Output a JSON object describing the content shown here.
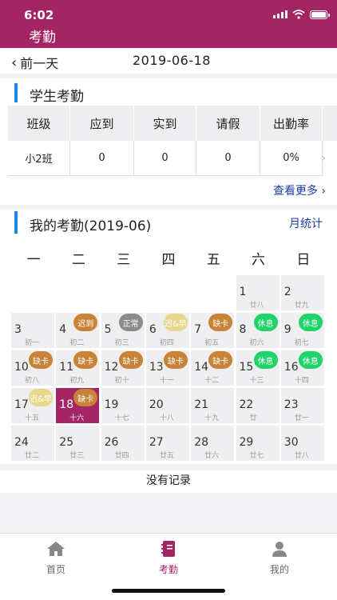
{
  "status": {
    "time": "6:02"
  },
  "header": {
    "title": "考勤"
  },
  "datebar": {
    "prev_label": "前一天",
    "date": "2019-06-18"
  },
  "student": {
    "title": "学生考勤",
    "columns": [
      "班级",
      "应到",
      "实到",
      "请假",
      "出勤率"
    ],
    "rows": [
      [
        "小2班",
        "0",
        "0",
        "0",
        "0%"
      ]
    ],
    "see_more": "查看更多"
  },
  "mine": {
    "title": "我的考勤(2019-06)",
    "monthly_link": "月统计",
    "weekdays": [
      "一",
      "二",
      "三",
      "四",
      "五",
      "六",
      "日"
    ],
    "badge_colors": {
      "late": "#c98337",
      "normal": "#8b8b8b",
      "late_early": "#e8d68a",
      "missing": "#c98337",
      "rest": "#20d46a"
    },
    "days": [
      {
        "d": "1",
        "l": "廿八",
        "col": 5,
        "row": 0
      },
      {
        "d": "2",
        "l": "廿九",
        "col": 6,
        "row": 0
      },
      {
        "d": "3",
        "l": "初一",
        "col": 0,
        "row": 1
      },
      {
        "d": "4",
        "l": "初二",
        "col": 1,
        "row": 1,
        "badge": "迟到",
        "type": "late"
      },
      {
        "d": "5",
        "l": "初三",
        "col": 2,
        "row": 1,
        "badge": "正常",
        "type": "normal"
      },
      {
        "d": "6",
        "l": "初四",
        "col": 3,
        "row": 1,
        "badge": "迟&早",
        "type": "late_early"
      },
      {
        "d": "7",
        "l": "初五",
        "col": 4,
        "row": 1,
        "badge": "缺卡",
        "type": "missing"
      },
      {
        "d": "8",
        "l": "初六",
        "col": 5,
        "row": 1,
        "badge": "休息",
        "type": "rest"
      },
      {
        "d": "9",
        "l": "初七",
        "col": 6,
        "row": 1,
        "badge": "休息",
        "type": "rest"
      },
      {
        "d": "10",
        "l": "初八",
        "col": 0,
        "row": 2,
        "badge": "缺卡",
        "type": "missing"
      },
      {
        "d": "11",
        "l": "初九",
        "col": 1,
        "row": 2,
        "badge": "缺卡",
        "type": "missing"
      },
      {
        "d": "12",
        "l": "初十",
        "col": 2,
        "row": 2,
        "badge": "缺卡",
        "type": "missing"
      },
      {
        "d": "13",
        "l": "十一",
        "col": 3,
        "row": 2,
        "badge": "缺卡",
        "type": "missing"
      },
      {
        "d": "14",
        "l": "十二",
        "col": 4,
        "row": 2,
        "badge": "缺卡",
        "type": "missing"
      },
      {
        "d": "15",
        "l": "十三",
        "col": 5,
        "row": 2,
        "badge": "休息",
        "type": "rest"
      },
      {
        "d": "16",
        "l": "十四",
        "col": 6,
        "row": 2,
        "badge": "休息",
        "type": "rest"
      },
      {
        "d": "17",
        "l": "十五",
        "col": 0,
        "row": 3,
        "badge": "迟&早",
        "type": "late_early"
      },
      {
        "d": "18",
        "l": "十六",
        "col": 1,
        "row": 3,
        "badge": "缺卡",
        "type": "missing",
        "today": true
      },
      {
        "d": "19",
        "l": "十七",
        "col": 2,
        "row": 3
      },
      {
        "d": "20",
        "l": "十八",
        "col": 3,
        "row": 3
      },
      {
        "d": "21",
        "l": "十九",
        "col": 4,
        "row": 3
      },
      {
        "d": "22",
        "l": "廿",
        "col": 5,
        "row": 3
      },
      {
        "d": "23",
        "l": "廿一",
        "col": 6,
        "row": 3
      },
      {
        "d": "24",
        "l": "廿二",
        "col": 0,
        "row": 4
      },
      {
        "d": "25",
        "l": "廿三",
        "col": 1,
        "row": 4
      },
      {
        "d": "26",
        "l": "廿四",
        "col": 2,
        "row": 4
      },
      {
        "d": "27",
        "l": "廿五",
        "col": 3,
        "row": 4
      },
      {
        "d": "28",
        "l": "廿六",
        "col": 4,
        "row": 4
      },
      {
        "d": "29",
        "l": "廿七",
        "col": 5,
        "row": 4
      },
      {
        "d": "30",
        "l": "廿八",
        "col": 6,
        "row": 4
      }
    ],
    "no_record": "没有记录"
  },
  "tabs": [
    {
      "label": "首页",
      "icon": "home-icon"
    },
    {
      "label": "考勤",
      "icon": "notebook-icon",
      "active": true
    },
    {
      "label": "我的",
      "icon": "person-icon"
    }
  ],
  "colors": {
    "brand": "#a32563",
    "accent_blue": "#1e88e5",
    "link": "#1f3ba8"
  }
}
